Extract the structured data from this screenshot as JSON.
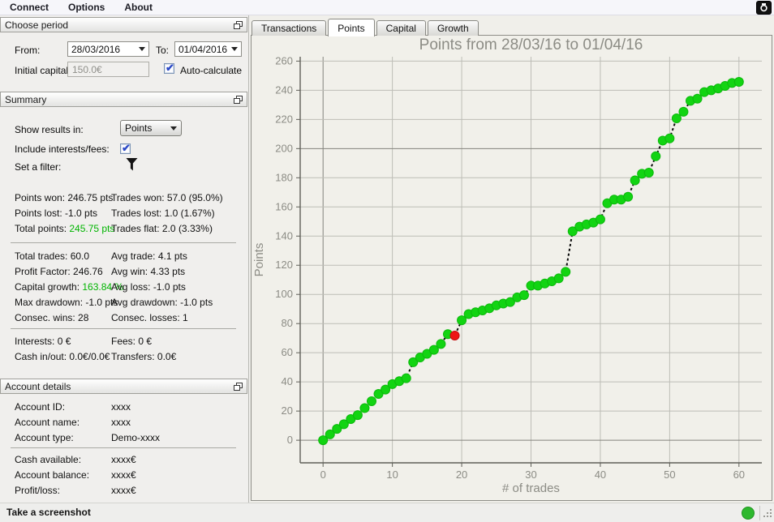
{
  "menu": {
    "items": [
      "Connect",
      "Options",
      "About"
    ]
  },
  "panels": {
    "choose_period": {
      "title": "Choose period",
      "from_label": "From:",
      "from_value": "28/03/2016",
      "to_label": "To:",
      "to_value": "01/04/2016",
      "initial_capital_label": "Initial capital:",
      "initial_capital_value": "150.0€",
      "auto_calculate_label": "Auto-calculate",
      "auto_calculate_checked": true
    },
    "summary": {
      "title": "Summary",
      "show_results_label": "Show results in:",
      "show_results_value": "Points",
      "include_interests_label": "Include interests/fees:",
      "include_interests_checked": true,
      "set_filter_label": "Set a filter:",
      "stats_group1": [
        {
          "l": "Points won:",
          "lv": "246.75 pts",
          "lg": false,
          "r": "Trades won:",
          "rv": "57.0 (95.0%)"
        },
        {
          "l": "Points lost:",
          "lv": "-1.0 pts",
          "lg": false,
          "r": "Trades lost:",
          "rv": "1.0 (1.67%)"
        },
        {
          "l": "Total points:",
          "lv": "245.75 pts",
          "lg": true,
          "r": "Trades flat:",
          "rv": "2.0 (3.33%)"
        }
      ],
      "stats_group2": [
        {
          "l": "Total trades:",
          "lv": "60.0",
          "lg": false,
          "r": "Avg trade:",
          "rv": "4.1 pts"
        },
        {
          "l": "Profit Factor:",
          "lv": "246.76",
          "lg": false,
          "r": "Avg win:",
          "rv": "4.33 pts"
        },
        {
          "l": "Capital growth:",
          "lv": "163.84 %",
          "lg": true,
          "r": "Avg loss:",
          "rv": "-1.0 pts"
        },
        {
          "l": "Max drawdown:",
          "lv": "-1.0 pts",
          "lg": false,
          "r": "Avg drawdown:",
          "rv": "-1.0 pts"
        },
        {
          "l": "Consec. wins:",
          "lv": "28",
          "lg": false,
          "r": "Consec. losses:",
          "rv": "1"
        }
      ],
      "stats_group3": [
        {
          "l": "Interests:",
          "lv": "0 €",
          "lg": false,
          "r": "Fees:",
          "rv": "0 €"
        },
        {
          "l": "Cash in/out:",
          "lv": "0.0€/0.0€",
          "lg": false,
          "r": "Transfers:",
          "rv": "0.0€"
        }
      ]
    },
    "account_details": {
      "title": "Account details",
      "rows_group1": [
        {
          "label": "Account ID:",
          "value": "xxxx"
        },
        {
          "label": "Account name:",
          "value": "xxxx"
        },
        {
          "label": "Account type:",
          "value": "Demo-xxxx"
        }
      ],
      "rows_group2": [
        {
          "label": "Cash available:",
          "value": "xxxx€"
        },
        {
          "label": "Account balance:",
          "value": "xxxx€"
        },
        {
          "label": "Profit/loss:",
          "value": "xxxx€"
        }
      ]
    }
  },
  "tabs": [
    {
      "label": "Transactions",
      "active": false
    },
    {
      "label": "Points",
      "active": true
    },
    {
      "label": "Capital",
      "active": false
    },
    {
      "label": "Growth",
      "active": false
    }
  ],
  "statusbar": {
    "hint": "Take a screenshot"
  },
  "colors": {
    "accent_green": "#00b400",
    "dot_green": "#12d412",
    "dot_red": "#ee1515",
    "status_green": "#2eb82e",
    "grid_light": "#bdbdb6",
    "grid_dark": "#83837c",
    "axis": "#5f5f58",
    "muted_text": "#8c8c85"
  },
  "chart_data": {
    "type": "scatter",
    "title": "Points from 28/03/16 to 01/04/16",
    "xlabel": "# of trades",
    "ylabel": "Points",
    "xlim": [
      -3.3,
      63.3
    ],
    "ylim": [
      -15.5,
      263
    ],
    "xticks": [
      0,
      10,
      20,
      30,
      40,
      50,
      60
    ],
    "yticks": [
      0,
      20,
      40,
      60,
      80,
      100,
      120,
      140,
      160,
      180,
      200,
      220,
      240,
      260
    ],
    "emphasized_y_gridlines": [
      0,
      200
    ],
    "grid": true,
    "legend": "none",
    "x": [
      0,
      1,
      2,
      3,
      4,
      5,
      6,
      7,
      8,
      9,
      10,
      11,
      12,
      13,
      14,
      15,
      16,
      17,
      18,
      19,
      20,
      21,
      22,
      23,
      24,
      25,
      26,
      27,
      28,
      29,
      30,
      31,
      32,
      33,
      34,
      35,
      36,
      37,
      38,
      39,
      40,
      41,
      42,
      43,
      44,
      45,
      46,
      47,
      48,
      49,
      50,
      51,
      52,
      53,
      54,
      55,
      56,
      57,
      58,
      59,
      60
    ],
    "values": [
      0,
      4,
      7.75,
      11,
      14.5,
      17.25,
      22,
      26.75,
      31.75,
      34.75,
      38.5,
      40.5,
      42.5,
      53.5,
      56.75,
      59.25,
      62,
      66,
      72.75,
      71.75,
      82.25,
      86.5,
      87.75,
      89,
      90.5,
      92.5,
      93.75,
      94.75,
      98,
      99.5,
      106,
      106,
      107.5,
      109,
      111,
      115.5,
      143.25,
      146.5,
      148,
      149.25,
      151.5,
      162.5,
      165,
      165,
      167,
      178.25,
      182.75,
      183.5,
      194.75,
      205.5,
      207,
      220.75,
      225.25,
      232.75,
      234.25,
      238.75,
      240,
      241.25,
      243,
      245,
      245.75
    ],
    "loss_index": 19,
    "flat_indices": [
      31,
      43
    ],
    "point_color": "#12d412",
    "loss_color": "#ee1515",
    "connector": "dashed-black"
  }
}
